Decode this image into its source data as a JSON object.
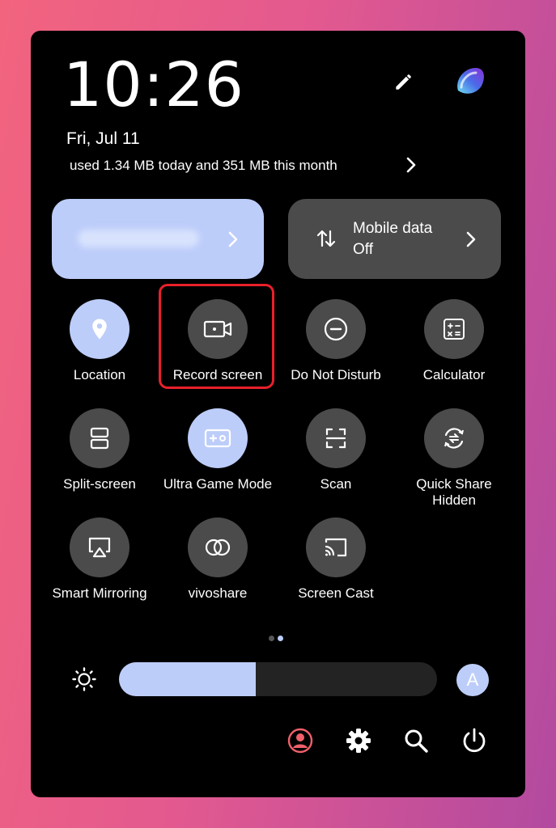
{
  "status": {
    "time": "10:26",
    "date": "Fri, Jul 11",
    "data_usage": "used 1.34 MB today and 351 MB this month"
  },
  "header_icons": [
    "edit-icon",
    "assistant-icon"
  ],
  "tiles": {
    "wifi": {
      "label": "",
      "icon": "chevron-right-icon"
    },
    "mobile_data": {
      "label": "Mobile data",
      "status": "Off",
      "icon": "data-arrows-icon"
    }
  },
  "toggles": [
    {
      "label": "Location",
      "icon": "location-pin-icon",
      "active": true
    },
    {
      "label": "Record screen",
      "icon": "video-camera-icon",
      "active": false,
      "highlighted": true
    },
    {
      "label": "Do Not Disturb",
      "icon": "minus-circle-icon",
      "active": false
    },
    {
      "label": "Calculator",
      "icon": "calculator-icon",
      "active": false
    },
    {
      "label": "Split-screen",
      "icon": "split-screen-icon",
      "active": false
    },
    {
      "label": "Ultra Game Mode",
      "icon": "gamepad-icon",
      "active": true
    },
    {
      "label": "Scan",
      "icon": "scan-icon",
      "active": false
    },
    {
      "label": "Quick Share Hidden",
      "icon": "quick-share-icon",
      "active": false
    },
    {
      "label": "Smart Mirroring",
      "icon": "airplay-icon",
      "active": false
    },
    {
      "label": "vivoshare",
      "icon": "link-icon",
      "active": false
    },
    {
      "label": "Screen Cast",
      "icon": "cast-icon",
      "active": false
    }
  ],
  "pagination": {
    "pages": 2,
    "current": 2
  },
  "brightness": {
    "level": 0.43,
    "auto_label": "A"
  },
  "bottom_bar": [
    "user-icon",
    "gear-icon",
    "search-icon",
    "power-icon"
  ],
  "colors": {
    "accent": "#bdcdfa",
    "tile_inactive": "#4b4b4b",
    "highlight_border": "#e8202a",
    "user_icon": "#f0606a"
  }
}
